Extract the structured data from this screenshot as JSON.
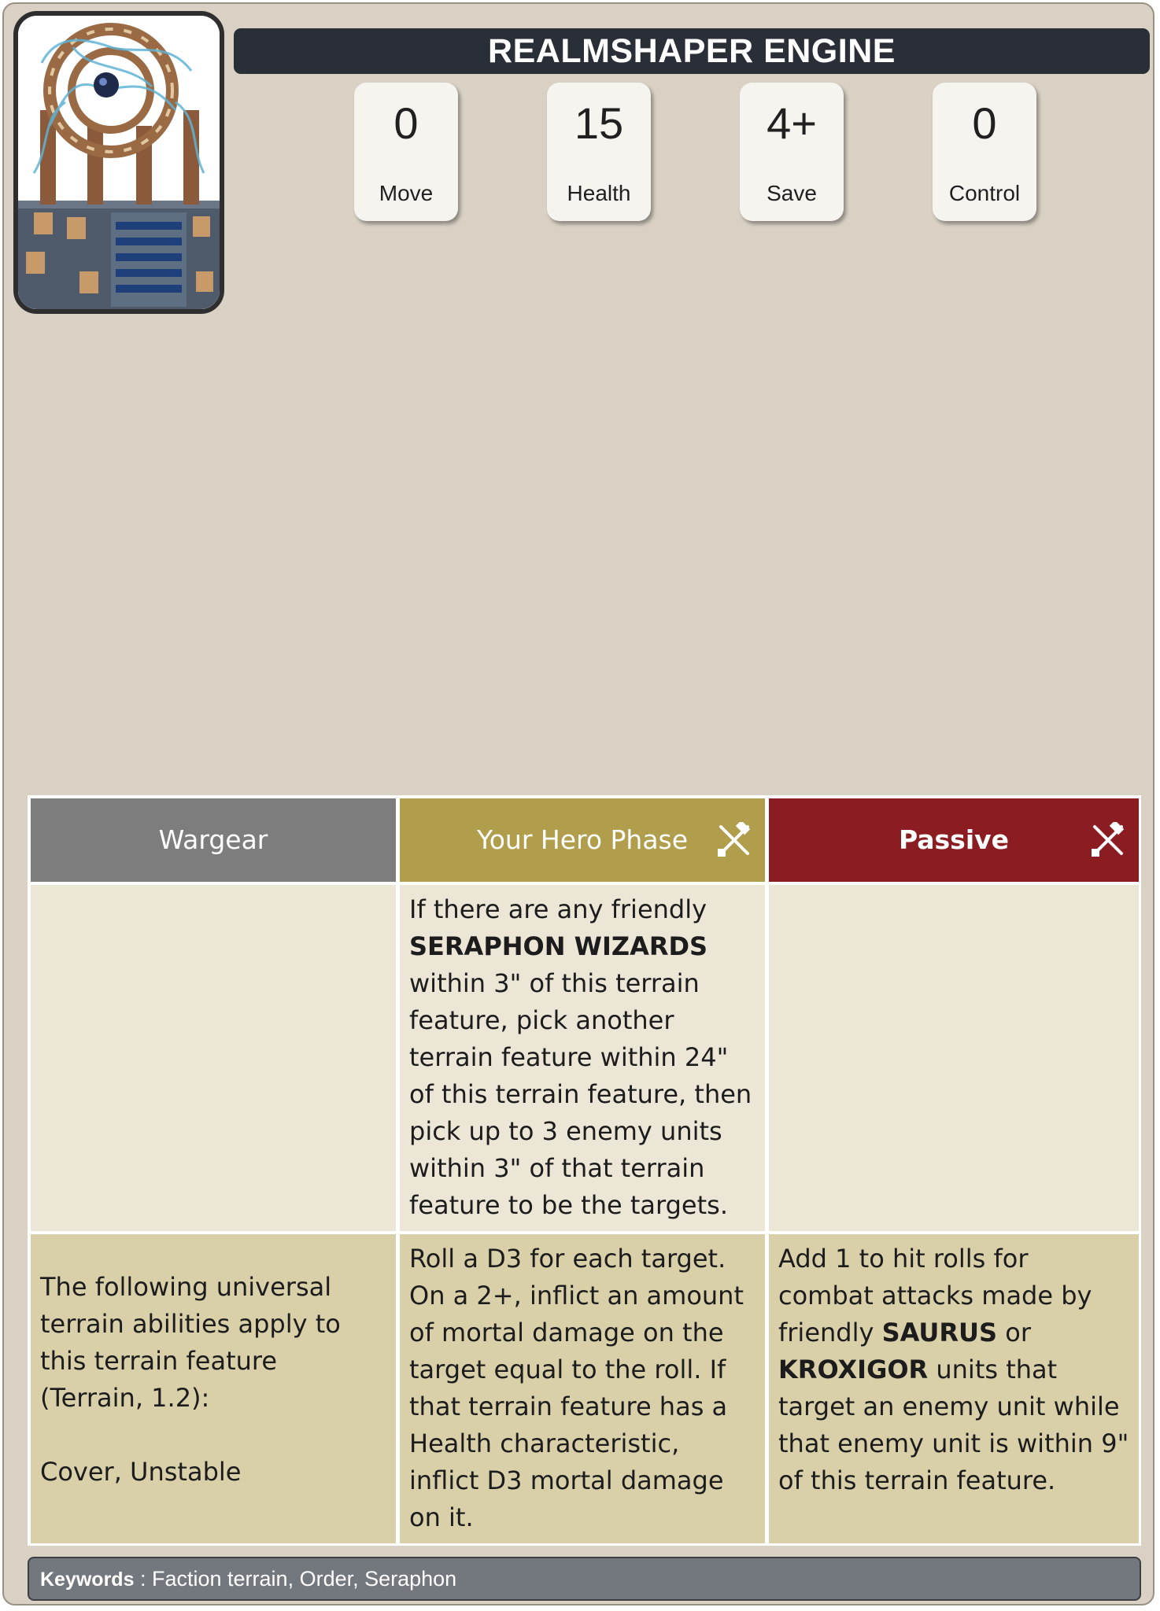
{
  "title": "REALMSHAPER ENGINE",
  "stats": [
    {
      "value": "0",
      "label": "Move"
    },
    {
      "value": "15",
      "label": "Health"
    },
    {
      "value": "4+",
      "label": "Save"
    },
    {
      "value": "0",
      "label": "Control"
    }
  ],
  "table": {
    "headers": {
      "wargear": "Wargear",
      "hero_phase": "Your Hero Phase",
      "passive": "Passive"
    },
    "hero_phase_row1": {
      "t1": "If there are any friendly ",
      "b1": "SERAPHON WIZARDS",
      "t2": " within 3\" of this terrain feature, pick another terrain feature within 24\" of this terrain feature, then pick up to 3 enemy units within 3\" of that terrain feature to be the targets."
    },
    "wargear_row2": "The following universal terrain abilities apply to this terrain feature (Terrain, 1.2):\n\nCover, Unstable",
    "hero_phase_row2": "Roll a D3 for each target. On a 2+, inflict an amount of mortal damage on the target equal to the roll. If that terrain feature has a Health characteristic, inflict D3 mortal damage on it.",
    "passive_row2": {
      "t1": "Add 1 to hit rolls for combat attacks made by friendly ",
      "b1": "SAURUS",
      "t2": " or ",
      "b2": "KROXIGOR",
      "t3": " units that target an enemy unit while that enemy unit is within 9\" of this terrain feature."
    }
  },
  "keywords": {
    "label": "Keywords",
    "separator": " : ",
    "values": "Faction terrain, Order, Seraphon"
  },
  "icons": [
    "crossed-weapons-icon"
  ]
}
